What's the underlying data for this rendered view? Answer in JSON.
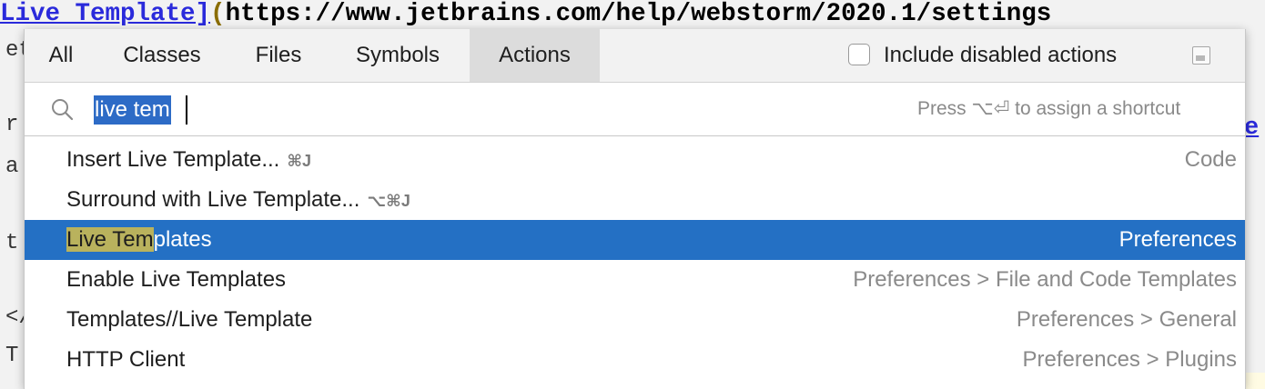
{
  "editor": {
    "top_link": "Live Template]",
    "top_paren": "(",
    "top_url": "https://www.jetbrains.com/help/webstorm/2020.1/settings",
    "gutter_fragments": [
      "et",
      "r",
      "a",
      "t",
      "</",
      "T"
    ],
    "right_fragment": "e"
  },
  "tabs": [
    {
      "label": "All"
    },
    {
      "label": "Classes"
    },
    {
      "label": "Files"
    },
    {
      "label": "Symbols"
    },
    {
      "label": "Actions",
      "active": true
    }
  ],
  "include_disabled": {
    "label": "Include disabled actions",
    "checked": false
  },
  "search": {
    "value": "live tem",
    "hint": "Press ⌥⏎ to assign a shortcut"
  },
  "results": [
    {
      "name": "Insert Live Template...",
      "highlight": "",
      "rest": "",
      "shortcut": "⌘J",
      "location": "Code"
    },
    {
      "name": "Surround with Live Template...",
      "highlight": "",
      "rest": "",
      "shortcut": "⌥⌘J",
      "location": ""
    },
    {
      "name": "",
      "highlight": "Live Tem",
      "rest": "plates",
      "shortcut": "",
      "location": "Preferences",
      "selected": true
    },
    {
      "name": "Enable Live Templates",
      "highlight": "",
      "rest": "",
      "shortcut": "",
      "location": "Preferences > File and Code Templates"
    },
    {
      "name": "Templates//Live Template",
      "highlight": "",
      "rest": "",
      "shortcut": "",
      "location": "Preferences > General"
    },
    {
      "name": "HTTP Client",
      "highlight": "",
      "rest": "",
      "shortcut": "",
      "location": "Preferences > Plugins"
    }
  ],
  "colors": {
    "selection": "#2470c4",
    "match_highlight": "#b9b25d",
    "tab_active": "#dcdcdc"
  }
}
